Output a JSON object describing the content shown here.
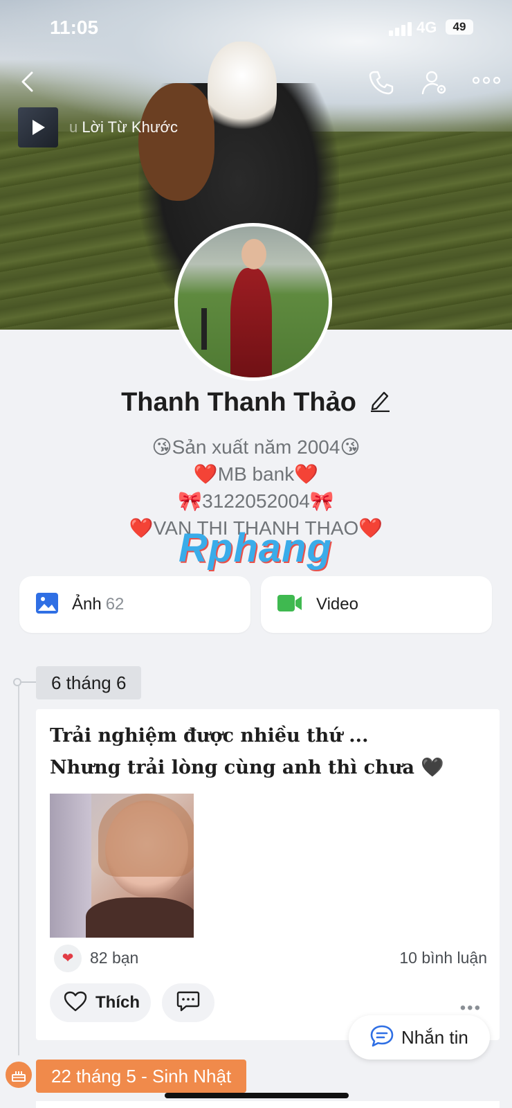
{
  "status_bar": {
    "time": "11:05",
    "network": "4G",
    "battery": "49"
  },
  "music": {
    "title_faded": "u",
    "title": "Lời Từ Khước"
  },
  "profile": {
    "name": "Thanh Thanh Thảo",
    "bio_lines": [
      "😘Sản xuất năm 2004😘",
      "❤️MB bank❤️",
      "🎀3122052004🎀",
      "❤️VAN THI THANH THAO❤️"
    ]
  },
  "watermark": "Rphang",
  "media": {
    "photos_label": "Ảnh",
    "photos_count": "62",
    "video_label": "Video"
  },
  "timeline": [
    {
      "date": "6 tháng 6",
      "text_line1": "Trải nghiệm được nhiều thứ ...",
      "text_line2": "Nhưng trải lòng cùng anh thì chưa 🖤",
      "reactions": "82 bạn",
      "comments": "10 bình luận",
      "like_label": "Thích"
    },
    {
      "date": "22 tháng 5 - Sinh Nhật"
    }
  ],
  "message_button": "Nhắn tin",
  "colors": {
    "accent_blue": "#2f6fe4",
    "video_green": "#3fb950",
    "birthday_orange": "#f08a4b",
    "heart_red": "#e23c45"
  },
  "icons": [
    "back-icon",
    "phone-icon",
    "user-settings-icon",
    "more-icon",
    "play-icon",
    "edit-icon",
    "photo-icon",
    "video-icon",
    "heart-icon",
    "comment-icon",
    "chat-icon",
    "cake-icon"
  ]
}
